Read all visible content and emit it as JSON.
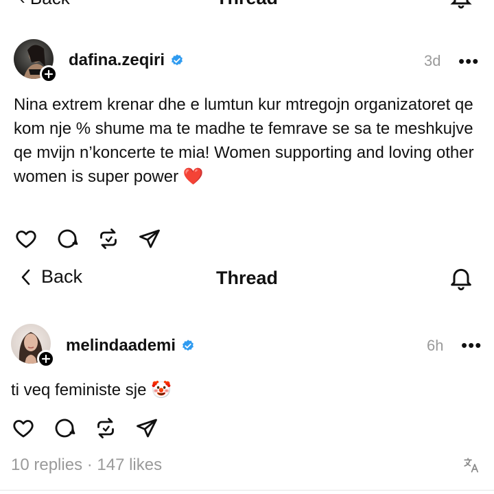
{
  "top_header": {
    "back_label": "Back",
    "title": "Thread"
  },
  "post1": {
    "username": "dafina.zeqiri",
    "time": "3d",
    "more": "•••",
    "text": "Nina extrem krenar dhe e lumtun kur mtregojn organizatoret qe kom nje % shume ma te madhe te femrave se sa te meshkujve qe mvijn n’koncerte te mia! Women supporting and loving other women is super power ❤️"
  },
  "header": {
    "back_label": "Back",
    "title": "Thread"
  },
  "post2": {
    "username": "melindaademi",
    "time": "6h",
    "more": "•••",
    "text": "ti veq feministe sje 🤡"
  },
  "stats": {
    "text": "10 replies · 147 likes"
  },
  "colors": {
    "verified": "#2f9bf0",
    "secondary_text": "#9a9a9a",
    "text": "#111111"
  },
  "icons": [
    "heart-icon",
    "comment-icon",
    "repost-icon",
    "share-icon",
    "bell-icon",
    "back-chevron-icon",
    "translate-icon",
    "verified-icon",
    "plus-icon"
  ]
}
